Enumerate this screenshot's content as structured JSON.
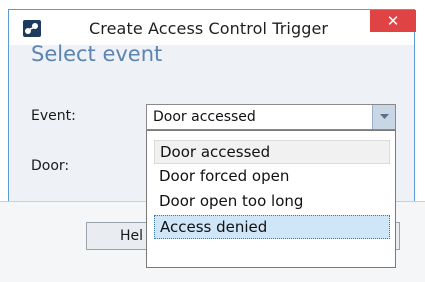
{
  "window": {
    "title": "Create Access Control Trigger",
    "close_glyph": "✕",
    "icon": "access-control-app-icon"
  },
  "section": {
    "title": "Select event"
  },
  "form": {
    "event_label": "Event:",
    "event_value": "Door accessed",
    "door_label": "Door:"
  },
  "dropdown": {
    "options": [
      "Door accessed",
      "Door forced open",
      "Door open too long",
      "Access denied"
    ],
    "selected_index": 0,
    "hovered_index": 3
  },
  "footer": {
    "help_label": "Hel"
  },
  "colors": {
    "accent": "#5b84b1",
    "close": "#e04343",
    "highlight": "#cfe6f8"
  }
}
